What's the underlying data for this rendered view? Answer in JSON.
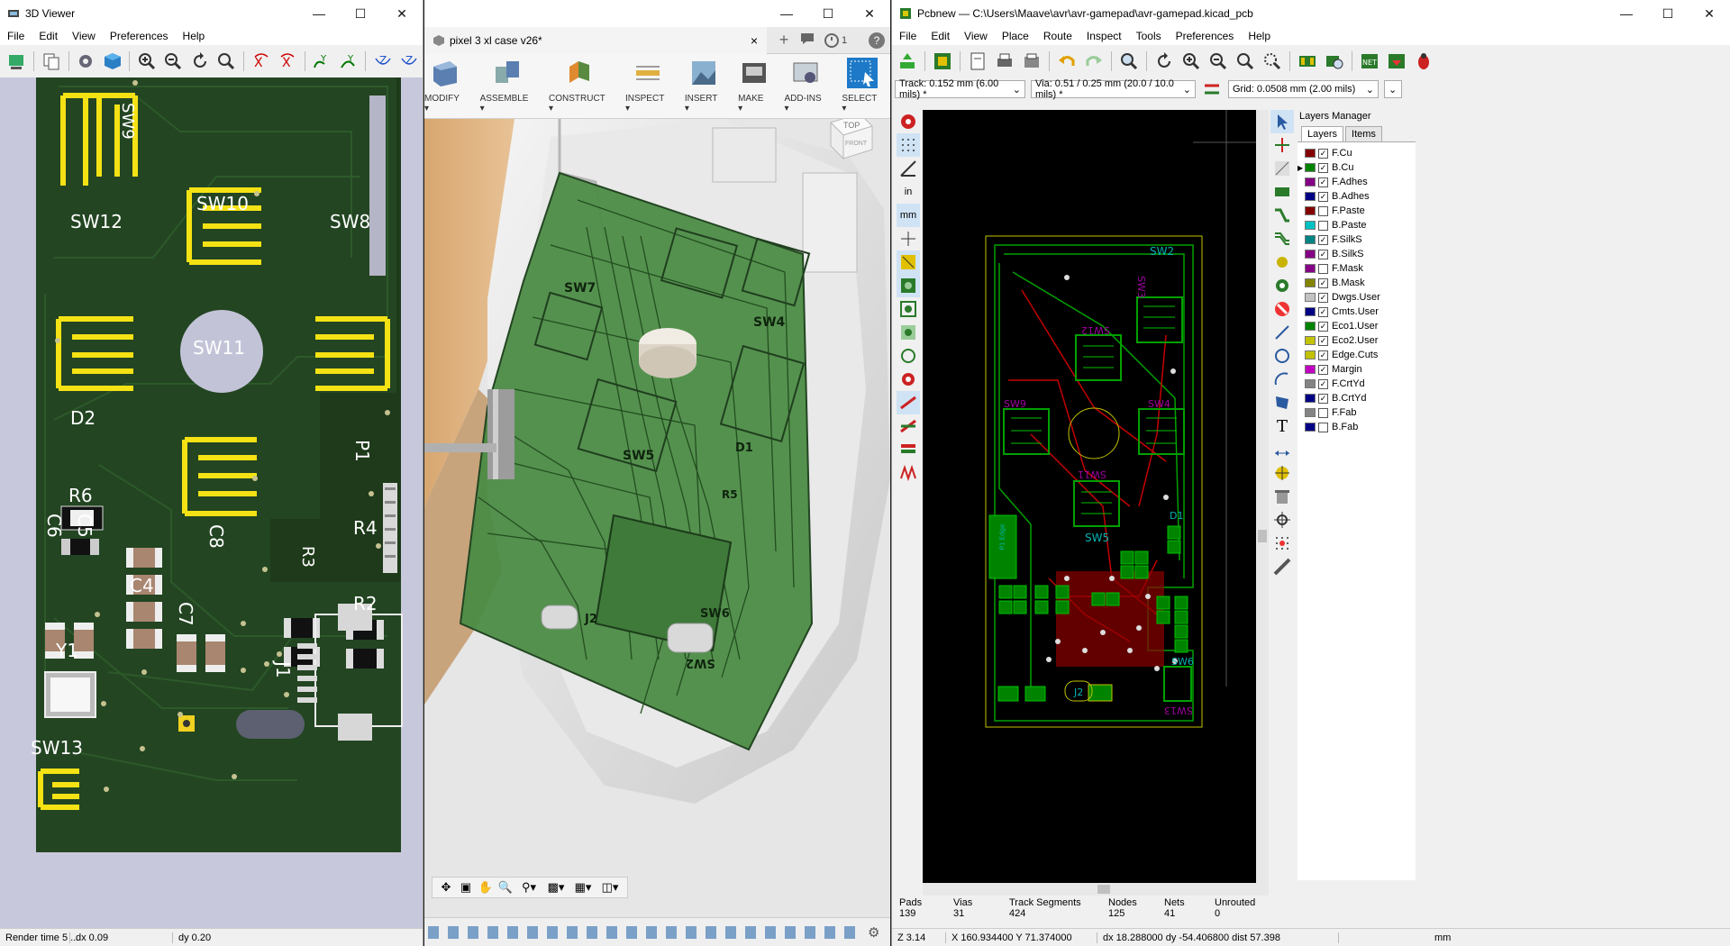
{
  "viewer3d": {
    "title": "3D Viewer",
    "menu": [
      "File",
      "Edit",
      "View",
      "Preferences",
      "Help"
    ],
    "labels": {
      "sw9": "SW9",
      "sw10": "SW10",
      "sw12": "SW12",
      "sw8": "SW8",
      "sw11": "SW11",
      "d2": "D2",
      "r6": "R6",
      "c6": "C6",
      "c5": "C5",
      "c4": "C4",
      "c8": "C8",
      "c7": "C7",
      "r4": "R4",
      "r3": "R3",
      "r2": "R2",
      "p1": "P1",
      "y1": "Y1",
      "j1": "J1",
      "sw13": "SW13"
    },
    "status": {
      "render": "Render time 5 ...",
      "dx": "dx 0.09",
      "dy": "dy 0.20"
    }
  },
  "fusion": {
    "tab_title": "pixel 3 xl case v26*",
    "tab_close": "×",
    "counter": "1",
    "groups": [
      "MODIFY ▾",
      "ASSEMBLE ▾",
      "CONSTRUCT ▾",
      "INSPECT ▾",
      "INSERT ▾",
      "MAKE ▾",
      "ADD-INS ▾",
      "SELECT ▾"
    ],
    "viewcube": {
      "top": "TOP",
      "front": "FRONT"
    },
    "labels": {
      "sw7": "SW7",
      "sw4": "SW4",
      "sw5": "SW5",
      "d1": "D1",
      "j2": "J2",
      "sw6": "SW6",
      "sw2": "SW2",
      "r5": "R5"
    }
  },
  "kicad": {
    "title": "Pcbnew — C:\\Users\\Maave\\avr\\avr-gamepad\\avr-gamepad.kicad_pcb",
    "menu": [
      "File",
      "Edit",
      "View",
      "Place",
      "Route",
      "Inspect",
      "Tools",
      "Preferences",
      "Help"
    ],
    "track": "Track: 0.152 mm (6.00 mils) *",
    "via": "Via: 0.51 / 0.25 mm (20.0 / 10.0 mils) *",
    "grid": "Grid: 0.0508 mm (2.00 mils)",
    "layers_manager": "Layers Manager",
    "tabs": [
      "Layers",
      "Items"
    ],
    "layers": [
      {
        "name": "F.Cu",
        "color": "#840000",
        "checked": true
      },
      {
        "name": "B.Cu",
        "color": "#008400",
        "checked": true
      },
      {
        "name": "F.Adhes",
        "color": "#840084",
        "checked": true
      },
      {
        "name": "B.Adhes",
        "color": "#000084",
        "checked": true
      },
      {
        "name": "F.Paste",
        "color": "#840000",
        "checked": false
      },
      {
        "name": "B.Paste",
        "color": "#00c2c2",
        "checked": false
      },
      {
        "name": "F.SilkS",
        "color": "#008484",
        "checked": true
      },
      {
        "name": "B.SilkS",
        "color": "#840084",
        "checked": true
      },
      {
        "name": "F.Mask",
        "color": "#840084",
        "checked": false
      },
      {
        "name": "B.Mask",
        "color": "#848400",
        "checked": true
      },
      {
        "name": "Dwgs.User",
        "color": "#c2c2c2",
        "checked": true
      },
      {
        "name": "Cmts.User",
        "color": "#000084",
        "checked": true
      },
      {
        "name": "Eco1.User",
        "color": "#008400",
        "checked": true
      },
      {
        "name": "Eco2.User",
        "color": "#c2c200",
        "checked": true
      },
      {
        "name": "Edge.Cuts",
        "color": "#c2c200",
        "checked": true
      },
      {
        "name": "Margin",
        "color": "#c200c2",
        "checked": true
      },
      {
        "name": "F.CrtYd",
        "color": "#848484",
        "checked": true
      },
      {
        "name": "B.CrtYd",
        "color": "#000084",
        "checked": true
      },
      {
        "name": "F.Fab",
        "color": "#848484",
        "checked": false
      },
      {
        "name": "B.Fab",
        "color": "#000084",
        "checked": false
      }
    ],
    "pcb_labels": {
      "sw2": "SW2",
      "sw3": "SW3",
      "sw12": "SW12",
      "sw4": "SW4",
      "sw11": "SW11",
      "sw5": "SW5",
      "d1": "D1",
      "sw6": "SW6",
      "j2": "J2",
      "sw13": "SW13",
      "sw9": "SW9",
      "p1": "P1 Edge"
    },
    "stats": [
      {
        "label": "Pads",
        "value": "139"
      },
      {
        "label": "Vias",
        "value": "31"
      },
      {
        "label": "Track Segments",
        "value": "424"
      },
      {
        "label": "Nodes",
        "value": "125"
      },
      {
        "label": "Nets",
        "value": "41"
      },
      {
        "label": "Unrouted",
        "value": "0"
      }
    ],
    "status": {
      "zoom": "Z 3.14",
      "xy": "X 160.934400  Y 71.374000",
      "dxdy": "dx 18.288000  dy -54.406800  dist 57.398",
      "unit": "mm"
    }
  }
}
